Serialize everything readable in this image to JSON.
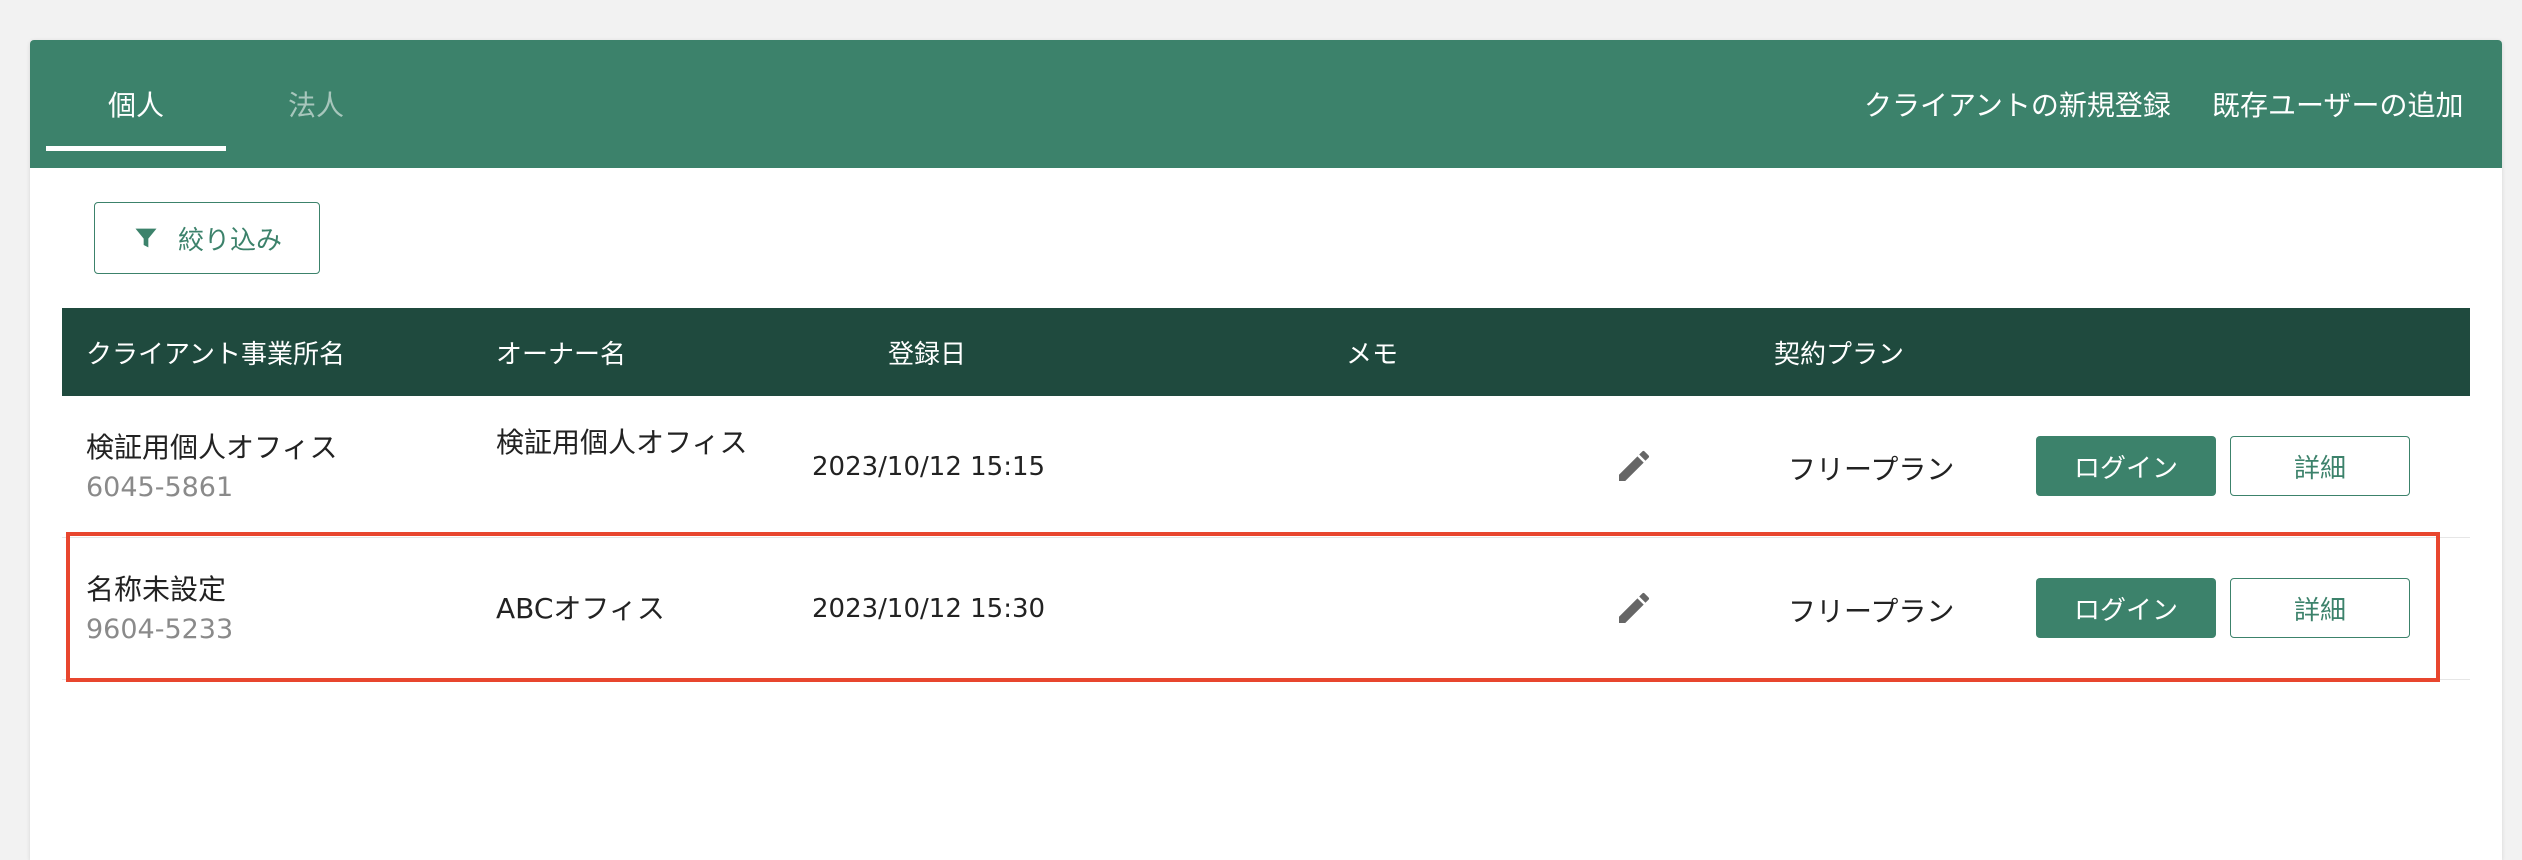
{
  "tabs": [
    {
      "label": "個人",
      "active": true
    },
    {
      "label": "法人",
      "active": false
    }
  ],
  "header_actions": {
    "new_client": "クライアントの新規登録",
    "add_user": "既存ユーザーの追加"
  },
  "filter": {
    "label": "絞り込み",
    "icon": "filter-icon"
  },
  "table": {
    "headers": [
      "クライアント事業所名",
      "オーナー名",
      "登録日",
      "メモ",
      "契約プラン"
    ],
    "rows": [
      {
        "name": "検証用個人オフィス",
        "code": "6045-5861",
        "owner": "検証用個人オフィス",
        "date": "2023/10/12 15:15",
        "plan": "フリープラン",
        "login_label": "ログイン",
        "detail_label": "詳細"
      },
      {
        "name": "名称未設定",
        "code": "9604-5233",
        "owner": "ABCオフィス",
        "date": "2023/10/12 15:30",
        "plan": "フリープラン",
        "login_label": "ログイン",
        "detail_label": "詳細"
      }
    ]
  },
  "colors": {
    "header_green": "#3c826b",
    "table_header": "#1f4a3e",
    "highlight": "#e8462e"
  }
}
